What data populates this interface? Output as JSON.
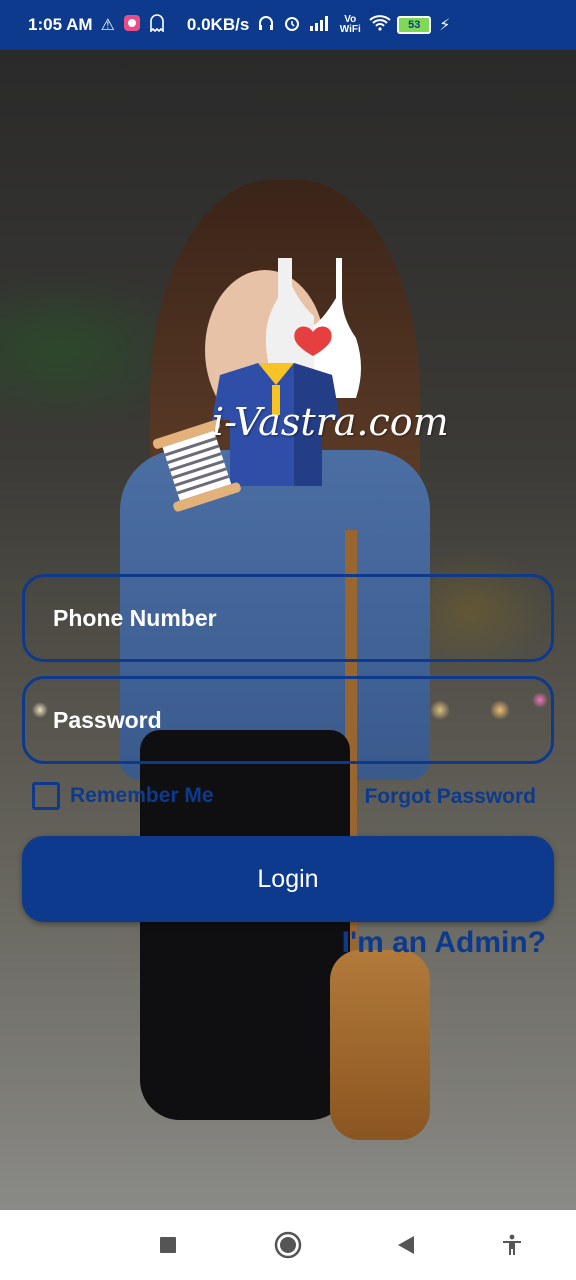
{
  "status_bar": {
    "time": "1:05 AM",
    "net_speed": "0.0KB/s",
    "network_label": "Vo WiFi",
    "battery": "53"
  },
  "logo": {
    "brand_text": "i-Vastra.com",
    "icons": [
      "tank-top-heart-icon",
      "polo-shirt-icon",
      "thread-spool-icon"
    ]
  },
  "form": {
    "phone_placeholder": "Phone Number",
    "password_placeholder": "Password",
    "remember_label": "Remember Me",
    "forgot_label": "Forgot Password",
    "login_label": "Login",
    "admin_label": "I'm an Admin?"
  },
  "colors": {
    "accent": "#0d3a8c",
    "status_bar": "#0d3a8c",
    "nav_bar": "#ffffff"
  },
  "nav": {
    "icons": [
      "recents-square-icon",
      "home-circle-icon",
      "back-triangle-icon",
      "accessibility-icon"
    ]
  }
}
